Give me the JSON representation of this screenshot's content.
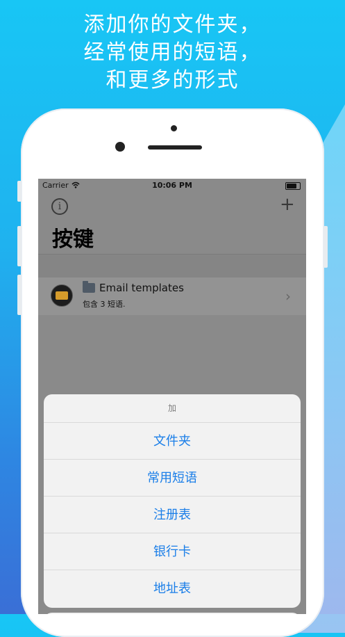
{
  "headline": {
    "line1": "添加你的文件夹，",
    "line2": "经常使用的短语，",
    "line3": "和更多的形式"
  },
  "status_bar": {
    "carrier": "Carrier",
    "time": "10:06 PM"
  },
  "nav": {
    "title": "按键",
    "info_symbol": "i",
    "add_symbol": "+"
  },
  "list": {
    "items": [
      {
        "title": "Email templates",
        "subtitle": "包含 3 短语.",
        "chevron": "›"
      }
    ]
  },
  "action_sheet": {
    "title": "加",
    "actions": [
      "文件夹",
      "常用短语",
      "注册表",
      "银行卡",
      "地址表"
    ]
  },
  "colors": {
    "accent": "#1a7ee8",
    "background_top": "#18c6f5",
    "background_bottom": "#3a6fd6"
  }
}
